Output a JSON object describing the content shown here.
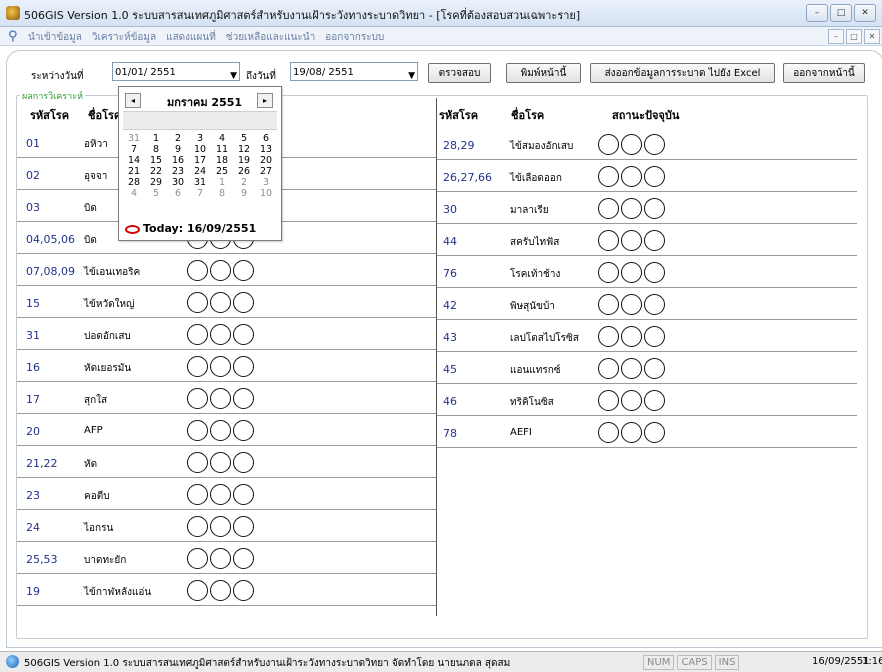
{
  "window": {
    "title": "506GIS Version 1.0  ระบบสารสนเทศภูมิศาสตร์สำหรับงานเฝ้าระวังทางระบาดวิทยา - [โรคที่ต้องสอบสวนเฉพาะราย]",
    "controls": [
      "–",
      "□",
      "✕"
    ]
  },
  "menu": {
    "items": [
      "นำเข้าข้อมูล",
      "วิเคราะห์ข้อมูล",
      "แสดงแผนที่",
      "ช่วยเหลือและแนะนำ",
      "ออกจากระบบ"
    ]
  },
  "toolbar": {
    "from_label": "ระหว่างวันที่",
    "from_date": "01/01/ 2551",
    "to_label": "ถึงวันที่",
    "to_date": "19/08/ 2551",
    "check_button": "ตรวจสอบ",
    "print_button": "พิมพ์หน้านี้",
    "export_button": "ส่งออกข้อมูลการระบาด ไปยัง Excel",
    "exit_button": "ออกจากหน้านี้"
  },
  "results": {
    "legend": "ผลการวิเคราะห์",
    "headers": {
      "code": "รหัสโรค",
      "name": "ชื่อโรค",
      "status": "สถานะปัจจุบัน"
    },
    "left_rows": [
      {
        "code": "01",
        "name": "อหิวา"
      },
      {
        "code": "02",
        "name": "อุจจา"
      },
      {
        "code": "03",
        "name": "บิด"
      },
      {
        "code": "04,05,06",
        "name": "บิด"
      },
      {
        "code": "07,08,09",
        "name": "ไข้เอนเทอริค"
      },
      {
        "code": "15",
        "name": "ไข้หวัดใหญ่"
      },
      {
        "code": "31",
        "name": "ปอดอักเสบ"
      },
      {
        "code": "16",
        "name": "หัดเยอรมัน"
      },
      {
        "code": "17",
        "name": "สุกใส"
      },
      {
        "code": "20",
        "name": "AFP"
      },
      {
        "code": "21,22",
        "name": "หัด"
      },
      {
        "code": "23",
        "name": "คอตีบ"
      },
      {
        "code": "24",
        "name": "ไอกรน"
      },
      {
        "code": "25,53",
        "name": "บาดทะยัก"
      },
      {
        "code": "19",
        "name": "ไข้กาฬหลังแอ่น"
      }
    ],
    "right_rows": [
      {
        "code": "28,29",
        "name": "ไข้สมองอักเสบ"
      },
      {
        "code": "26,27,66",
        "name": "ไข้เลือดออก"
      },
      {
        "code": "30",
        "name": "มาลาเรีย"
      },
      {
        "code": "44",
        "name": "สครับไทฟัส"
      },
      {
        "code": "76",
        "name": "โรคเท้าช้าง"
      },
      {
        "code": "42",
        "name": "พิษสุนัขบ้า"
      },
      {
        "code": "43",
        "name": "เลปโตสไปโรซิส"
      },
      {
        "code": "45",
        "name": "แอนแทรกซ์"
      },
      {
        "code": "46",
        "name": "ทริคิโนซิส"
      },
      {
        "code": "78",
        "name": "AEFI"
      }
    ]
  },
  "calendar": {
    "month_label": "มกราคม 2551",
    "prev": "◂",
    "next": "▸",
    "weeks": [
      [
        "31",
        "1",
        "2",
        "3",
        "4",
        "5",
        "6"
      ],
      [
        "7",
        "8",
        "9",
        "10",
        "11",
        "12",
        "13"
      ],
      [
        "14",
        "15",
        "16",
        "17",
        "18",
        "19",
        "20"
      ],
      [
        "21",
        "22",
        "23",
        "24",
        "25",
        "26",
        "27"
      ],
      [
        "28",
        "29",
        "30",
        "31",
        "1",
        "2",
        "3"
      ],
      [
        "4",
        "5",
        "6",
        "7",
        "8",
        "9",
        "10"
      ]
    ],
    "today_label": "Today: 16/09/2551"
  },
  "statusbar": {
    "text": "506GIS Version 1.0 ระบบสารสนเทศภูมิศาสตร์สำหรับงานเฝ้าระวังทางระบาดวิทยา จัดทำโดย นายนภดล สุดสม",
    "keys": [
      "NUM",
      "CAPS",
      "INS"
    ],
    "date": "16/09/2551",
    "time": "1:16"
  },
  "icons": {
    "app": "app-globe-icon",
    "menu": "search-icon",
    "status": "globe-icon"
  }
}
